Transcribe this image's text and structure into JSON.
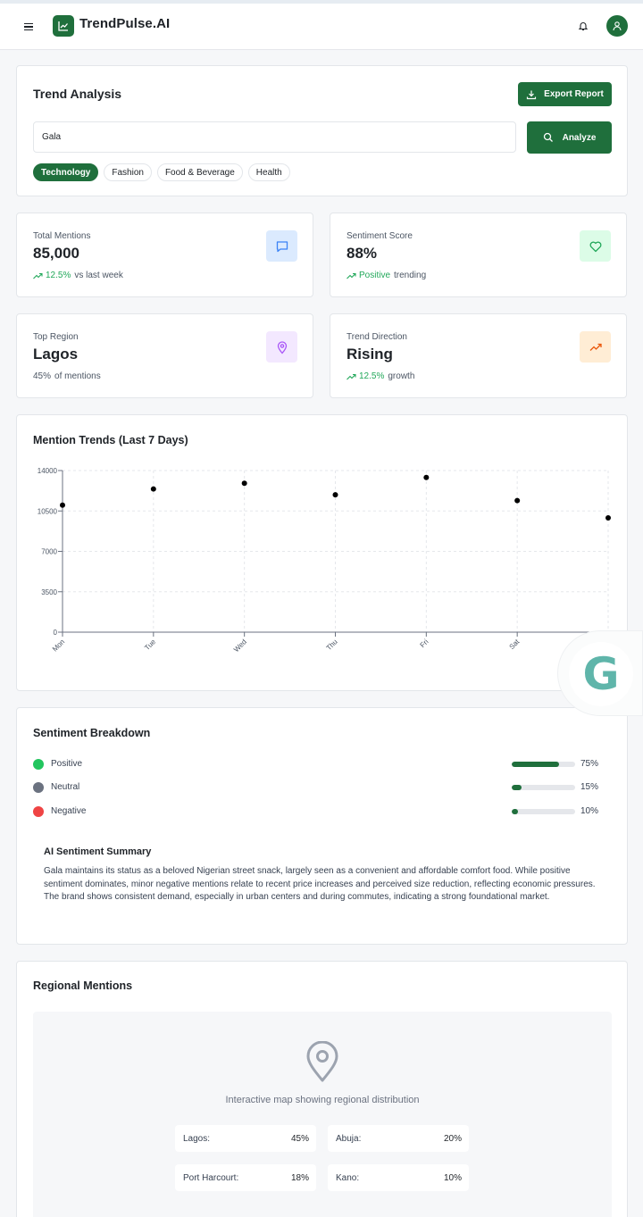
{
  "app": {
    "brand": "TrendPulse.AI"
  },
  "colors": {
    "primary": "#1f6f3c",
    "positive": "#22c55e",
    "neutral": "#6b7280",
    "negative": "#ef4444",
    "trend_up": "#22a85a"
  },
  "icons": {
    "menu": "hamburger-icon",
    "logo": "chart-line-icon",
    "bell": "bell-icon",
    "avatar": "user-icon",
    "export": "download-icon",
    "analyze": "search-icon",
    "mentions": "message-icon",
    "sentiment": "heart-icon",
    "region": "map-pin-icon",
    "trend": "trending-up-icon"
  },
  "trend_analysis": {
    "title": "Trend Analysis",
    "export_label": "Export Report",
    "search_value": "Gala",
    "analyze_label": "Analyze",
    "categories": [
      "Technology",
      "Fashion",
      "Food & Beverage",
      "Health"
    ],
    "active_category": "Technology"
  },
  "stats": {
    "mentions": {
      "label": "Total Mentions",
      "value": "85,000",
      "change": "12.5%",
      "suffix": "vs last week"
    },
    "sentiment": {
      "label": "Sentiment Score",
      "value": "88%",
      "change": "Positive",
      "suffix": "trending"
    },
    "region": {
      "label": "Top Region",
      "value": "Lagos",
      "change": "45%",
      "suffix": "of mentions"
    },
    "direction": {
      "label": "Trend Direction",
      "value": "Rising",
      "change": "12.5%",
      "suffix": "growth"
    }
  },
  "chart_data": {
    "type": "scatter",
    "title": "Mention Trends (Last 7 Days)",
    "categories": [
      "Mon",
      "Tue",
      "Wed",
      "Thu",
      "Fri",
      "Sat",
      "Sun"
    ],
    "values": [
      11000,
      12400,
      12900,
      11900,
      13400,
      11400,
      9900
    ],
    "xlabel": "",
    "ylabel": "",
    "ylim": [
      0,
      14000
    ],
    "yticks": [
      "0",
      "3500",
      "7000",
      "10500",
      "14000"
    ],
    "grid": true
  },
  "sentiment": {
    "title": "Sentiment Breakdown",
    "items": [
      {
        "label": "Positive",
        "percent": 75,
        "percent_label": "75%"
      },
      {
        "label": "Neutral",
        "percent": 15,
        "percent_label": "15%"
      },
      {
        "label": "Negative",
        "percent": 10,
        "percent_label": "10%"
      }
    ],
    "ai_title": "AI Sentiment Summary",
    "ai_text": "Gala maintains its status as a beloved Nigerian street snack, largely seen as a convenient and affordable comfort food. While positive sentiment dominates, minor negative mentions relate to recent price increases and perceived size reduction, reflecting economic pressures. The brand shows consistent demand, especially in urban centers and during commutes, indicating a strong foundational market."
  },
  "regional": {
    "title": "Regional Mentions",
    "caption": "Interactive map showing regional distribution",
    "regions": [
      {
        "name": "Lagos:",
        "value": "45%"
      },
      {
        "name": "Abuja:",
        "value": "20%"
      },
      {
        "name": "Port Harcourt:",
        "value": "18%"
      },
      {
        "name": "Kano:",
        "value": "10%"
      }
    ]
  },
  "widget": {
    "letter": "G"
  }
}
